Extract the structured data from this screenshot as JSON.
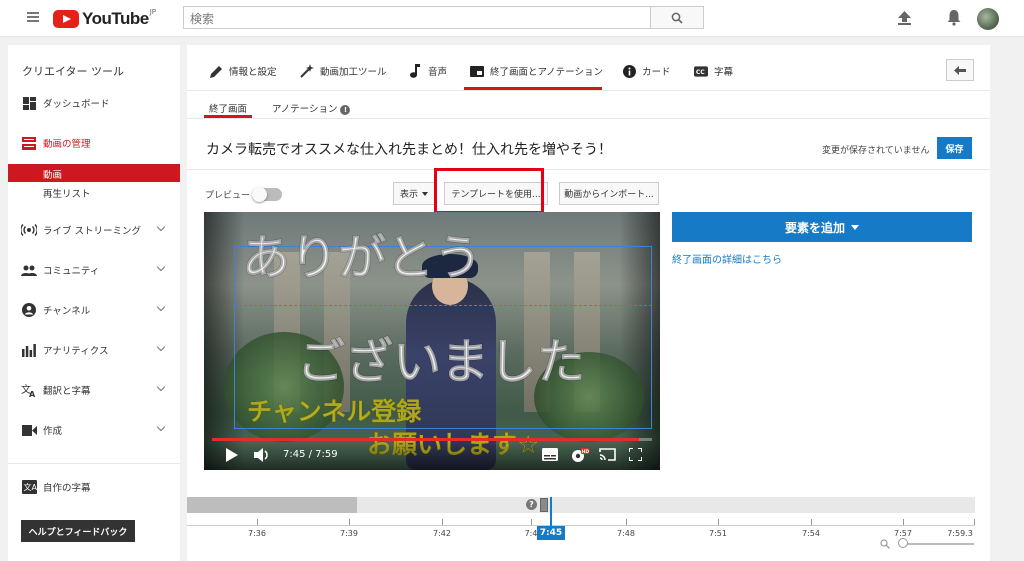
{
  "header": {
    "logo_text": "YouTube",
    "logo_region": "JP",
    "search_placeholder": "検索"
  },
  "sidebar": {
    "title": "クリエイター ツール",
    "items": [
      {
        "label": "ダッシュボード",
        "icon": "dashboard-icon"
      },
      {
        "label": "動画の管理",
        "icon": "video-manager-icon",
        "active": true
      },
      {
        "label": "ライブ ストリーミング",
        "icon": "live-icon"
      },
      {
        "label": "コミュニティ",
        "icon": "community-icon"
      },
      {
        "label": "チャンネル",
        "icon": "channel-icon"
      },
      {
        "label": "アナリティクス",
        "icon": "analytics-icon"
      },
      {
        "label": "翻訳と字幕",
        "icon": "translate-icon"
      },
      {
        "label": "作成",
        "icon": "create-icon"
      },
      {
        "label": "自作の字幕",
        "icon": "subtitles-icon"
      }
    ],
    "sub_items": [
      "動画",
      "再生リスト"
    ],
    "help_button": "ヘルプとフィードバック"
  },
  "tabs": [
    {
      "label": "情報と設定",
      "icon": "pencil-icon"
    },
    {
      "label": "動画加工ツール",
      "icon": "magic-wand-icon"
    },
    {
      "label": "音声",
      "icon": "music-note-icon"
    },
    {
      "label": "終了画面とアノテーション",
      "icon": "end-screen-icon",
      "active": true
    },
    {
      "label": "カード",
      "icon": "info-icon"
    },
    {
      "label": "字幕",
      "icon": "cc-icon"
    }
  ],
  "subtabs": [
    {
      "label": "終了画面",
      "active": true
    },
    {
      "label": "アノテーション"
    }
  ],
  "video": {
    "title": "カメラ転売でオススメな仕入れ先まとめ！仕入れ先を増やそう！",
    "unsaved_message": "変更が保存されていません",
    "save_label": "保存",
    "preview_label": "プレビュー",
    "view_button": "表示",
    "template_button": "テンプレートを使用...",
    "import_button": "動画からインポート...",
    "time_display": "7:45 / 7:59",
    "progress": 0.97,
    "overlay": {
      "line1": "ありがとう",
      "line2": "ございました",
      "line3": "チャンネル登録",
      "line4": "お願いします☆"
    }
  },
  "actions": {
    "add_element": "要素を追加",
    "details_link": "終了画面の詳細はこちら"
  },
  "timeline": {
    "current": "7:45",
    "ticks": [
      "7:36",
      "7:39",
      "7:42",
      "7:4",
      "7:48",
      "7:51",
      "7:54",
      "7:57",
      "7:59.3"
    ],
    "help_glyph": "?"
  },
  "colors": {
    "youtube_red": "#cc181e",
    "primary_blue": "#167ac6",
    "highlight_red": "#e60012"
  }
}
